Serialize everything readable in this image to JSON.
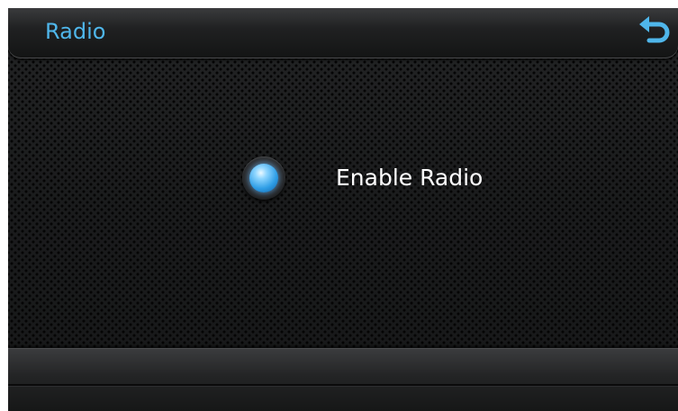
{
  "header": {
    "title": "Radio",
    "back_icon": "back-arrow-icon"
  },
  "main": {
    "option": {
      "label": "Enable Radio",
      "selected": true,
      "indicator_icon": "radio-button-icon"
    }
  },
  "colors": {
    "accent": "#4fb6ea",
    "label_text": "#ffffff",
    "background": "#1b1c1d"
  }
}
